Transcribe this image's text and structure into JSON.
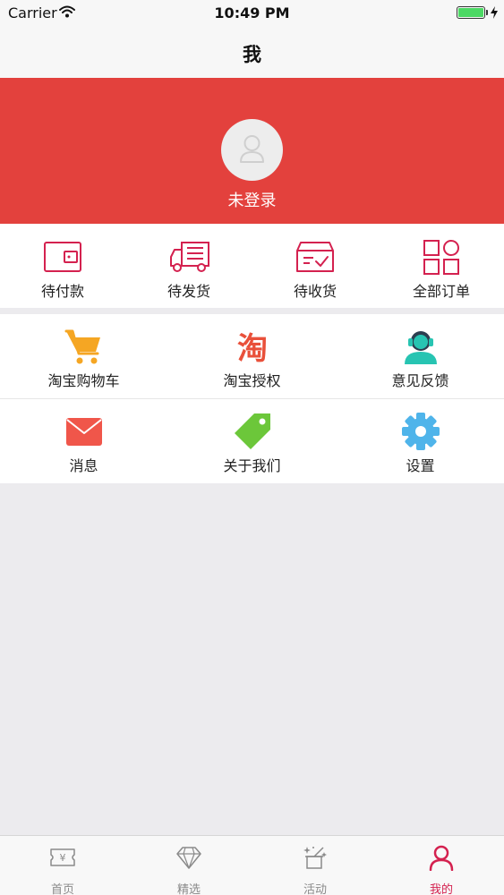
{
  "status_bar": {
    "carrier": "Carrier",
    "time": "10:49 PM"
  },
  "nav": {
    "title": "我"
  },
  "profile": {
    "login_status": "未登录"
  },
  "orders": [
    {
      "label": "待付款",
      "icon": "wallet-icon"
    },
    {
      "label": "待发货",
      "icon": "truck-icon"
    },
    {
      "label": "待收货",
      "icon": "package-check-icon"
    },
    {
      "label": "全部订单",
      "icon": "grid-icon"
    }
  ],
  "menu": [
    {
      "label": "淘宝购物车",
      "icon": "shopping-cart-icon"
    },
    {
      "label": "淘宝授权",
      "icon": "taobao-logo-icon",
      "icon_text": "淘"
    },
    {
      "label": "意见反馈",
      "icon": "headset-support-icon"
    },
    {
      "label": "消息",
      "icon": "envelope-icon"
    },
    {
      "label": "关于我们",
      "icon": "tag-icon"
    },
    {
      "label": "设置",
      "icon": "gear-icon"
    }
  ],
  "tabs": [
    {
      "label": "首页",
      "icon": "ticket-icon",
      "active": false
    },
    {
      "label": "精选",
      "icon": "diamond-icon",
      "active": false
    },
    {
      "label": "活动",
      "icon": "magic-box-icon",
      "active": false
    },
    {
      "label": "我的",
      "icon": "person-icon",
      "active": true
    }
  ],
  "colors": {
    "banner": "#e3413d",
    "accent": "#d4214f",
    "cart": "#f5a623",
    "taobao": "#e9503a",
    "support": "#27c4b2",
    "message": "#f0564a",
    "tag": "#6cc73a",
    "gear": "#4fb4ea"
  }
}
